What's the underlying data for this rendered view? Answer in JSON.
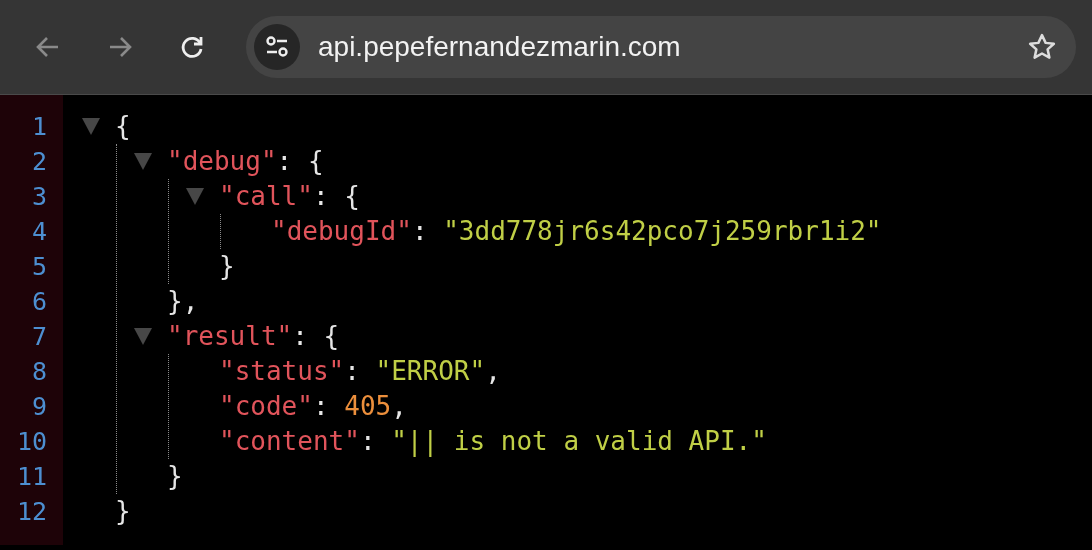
{
  "toolbar": {
    "back": {
      "disabled": true
    },
    "forward": {
      "disabled": true
    },
    "url": "api.pepefernandezmarin.com"
  },
  "viewer": {
    "line_numbers": [
      "1",
      "2",
      "3",
      "4",
      "5",
      "6",
      "7",
      "8",
      "9",
      "10",
      "11",
      "12"
    ],
    "root": {
      "kind": "object",
      "open": "{",
      "close": "}",
      "expanded": true,
      "children": [
        {
          "kind": "object",
          "key": "\"debug\"",
          "separator": ":",
          "open": "{",
          "close": "},",
          "expanded": true,
          "children": [
            {
              "kind": "object",
              "key": "\"call\"",
              "separator": ":",
              "open": "{",
              "close": "}",
              "expanded": true,
              "children": [
                {
                  "kind": "string",
                  "key": "\"debugId\"",
                  "separator": ":",
                  "value": "\"3dd778jr6s42pco7j259rbr1i2\""
                }
              ]
            }
          ]
        },
        {
          "kind": "object",
          "key": "\"result\"",
          "separator": ":",
          "open": "{",
          "close": "}",
          "expanded": true,
          "children": [
            {
              "kind": "string",
              "key": "\"status\"",
              "separator": ":",
              "value": "\"ERROR\"",
              "comma": ","
            },
            {
              "kind": "number",
              "key": "\"code\"",
              "separator": ":",
              "value": "405",
              "comma": ","
            },
            {
              "kind": "string",
              "key": "\"content\"",
              "separator": ":",
              "value": "\"|| is not a valid API.\""
            }
          ]
        }
      ]
    }
  }
}
